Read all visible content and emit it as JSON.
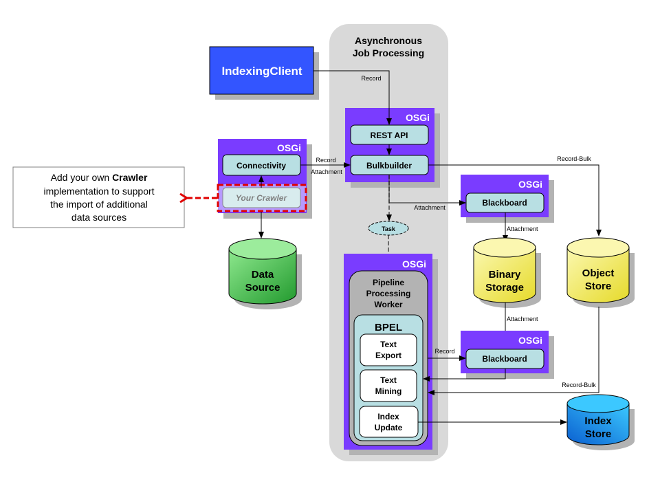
{
  "async_region": {
    "title_line1": "Asynchronous",
    "title_line2": "Job Processing"
  },
  "indexing_client": {
    "label": "IndexingClient"
  },
  "osgi_label": "OSGi",
  "crawler_group": {
    "connectivity": "Connectivity",
    "your_crawler": "Your Crawler"
  },
  "callout": {
    "line1_prefix": "Add your own ",
    "line1_bold": "Crawler",
    "line2": "implementation to support",
    "line3": "the import of additional",
    "line4": "data sources"
  },
  "api_group": {
    "rest_api": "REST API",
    "bulkbuilder": "Bulkbuilder"
  },
  "blackboard_top": {
    "label": "Blackboard"
  },
  "blackboard_bottom": {
    "label": "Blackboard"
  },
  "task": {
    "label": "Task"
  },
  "pipeline": {
    "title_line1": "Pipeline",
    "title_line2": "Processing",
    "title_line3": "Worker",
    "bpel": "BPEL",
    "steps": [
      {
        "line1": "Text",
        "line2": "Export"
      },
      {
        "line1": "Text",
        "line2": "Mining"
      },
      {
        "line1": "Index",
        "line2": "Update"
      }
    ]
  },
  "stores": {
    "data_source": {
      "line1": "Data",
      "line2": "Source",
      "color": "#3cb043"
    },
    "binary_storage": {
      "line1": "Binary",
      "line2": "Storage",
      "color": "#f0e040"
    },
    "object_store": {
      "line1": "Object",
      "line2": "Store",
      "color": "#f0e040"
    },
    "index_store": {
      "line1": "Index",
      "line2": "Store",
      "color": "#1e90e8"
    }
  },
  "edge_labels": {
    "client_record": "Record",
    "conn_record": "Record",
    "conn_attachment": "Attachment",
    "bulk_attachment": "Attachment",
    "record_bulk_top": "Record-Bulk",
    "bb_attachment_down": "Attachment",
    "binary_attachment_down": "Attachment",
    "export_record": "Record",
    "record_bulk_bottom": "Record-Bulk"
  },
  "colors": {
    "osgi_purple": "#7a3cff",
    "client_blue": "#3355ff",
    "component_fill": "#b8dfe3",
    "region_gray": "#d9d9d9",
    "shadow_gray": "#aaaaaa",
    "highlight_red": "#e00000"
  }
}
